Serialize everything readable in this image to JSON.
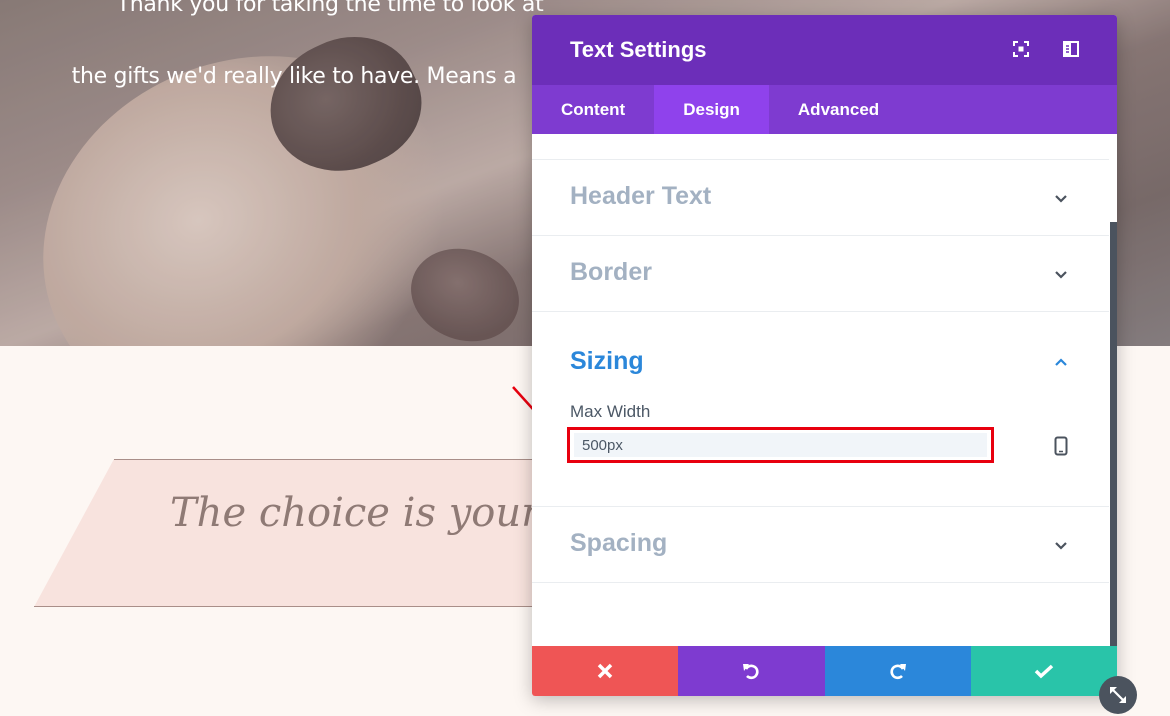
{
  "hero": {
    "line1": "Thank you for taking the time to look at",
    "line2": "the gifts we'd really like to have. Means a"
  },
  "ribbon": {
    "text": "The choice is yours"
  },
  "panel": {
    "title": "Text Settings",
    "tabs": [
      {
        "label": "Content",
        "active": false
      },
      {
        "label": "Design",
        "active": true
      },
      {
        "label": "Advanced",
        "active": false
      }
    ],
    "sections": [
      {
        "title": "Header Text",
        "state": "collapsed"
      },
      {
        "title": "Border",
        "state": "collapsed"
      },
      {
        "title": "Sizing",
        "state": "expanded"
      },
      {
        "title": "Spacing",
        "state": "collapsed"
      }
    ],
    "sizing": {
      "max_width_label": "Max Width",
      "max_width_value": "500px"
    },
    "footer_buttons": [
      "cancel-icon",
      "undo-icon",
      "redo-icon",
      "check-icon"
    ]
  },
  "colors": {
    "header": "#6c2eb9",
    "tabs": "#7e3bd0",
    "tab_active": "#8f42ec",
    "accent_blue": "#2b87da",
    "cancel": "#ef5555",
    "save": "#29c4a9",
    "highlight_red": "#e8000f"
  }
}
